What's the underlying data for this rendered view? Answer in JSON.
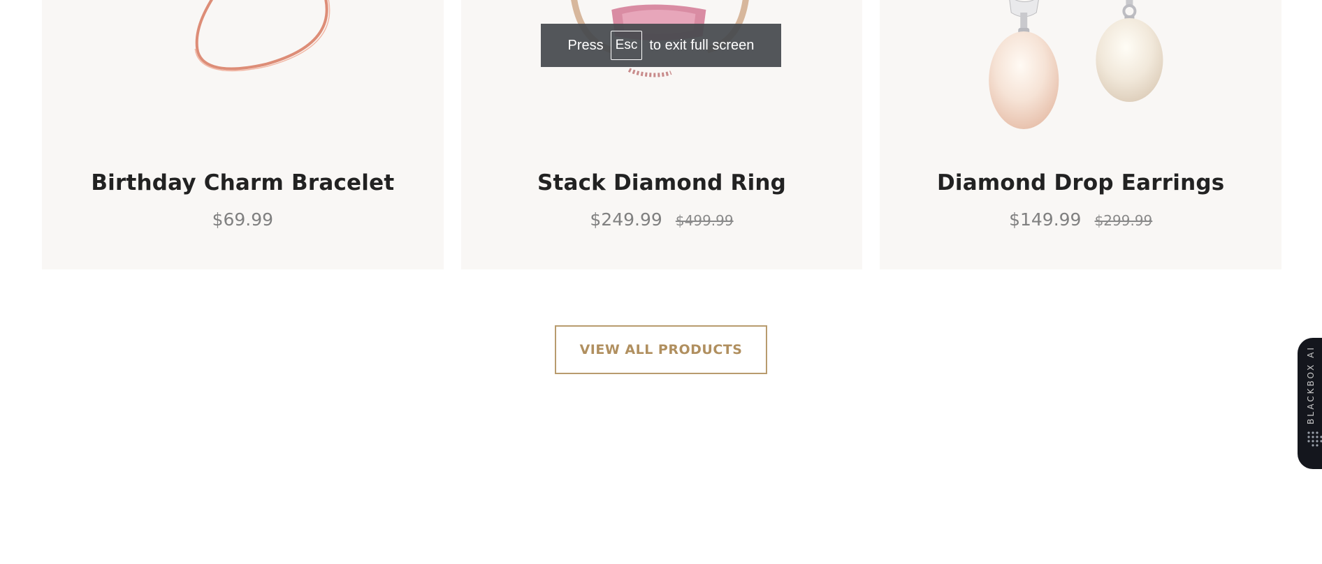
{
  "products": [
    {
      "name": "Birthday Charm Bracelet",
      "price": "$69.99",
      "original_price": ""
    },
    {
      "name": "Stack Diamond Ring",
      "price": "$249.99",
      "original_price": "$499.99"
    },
    {
      "name": "Diamond Drop Earrings",
      "price": "$149.99",
      "original_price": "$299.99"
    }
  ],
  "fullscreen_notice": {
    "press_text": "Press",
    "key_label": "Esc",
    "exit_text": "to exit full screen"
  },
  "view_all_label": "VIEW ALL PRODUCTS",
  "side_tab": {
    "label": "BLACKBOX AI",
    "logo_icon": "dotted-grid-icon"
  },
  "colors": {
    "card_background": "#f9f7f5",
    "accent_gold": "#b08f5f",
    "side_tab_background": "#14161d",
    "notice_background": "#46494d"
  }
}
